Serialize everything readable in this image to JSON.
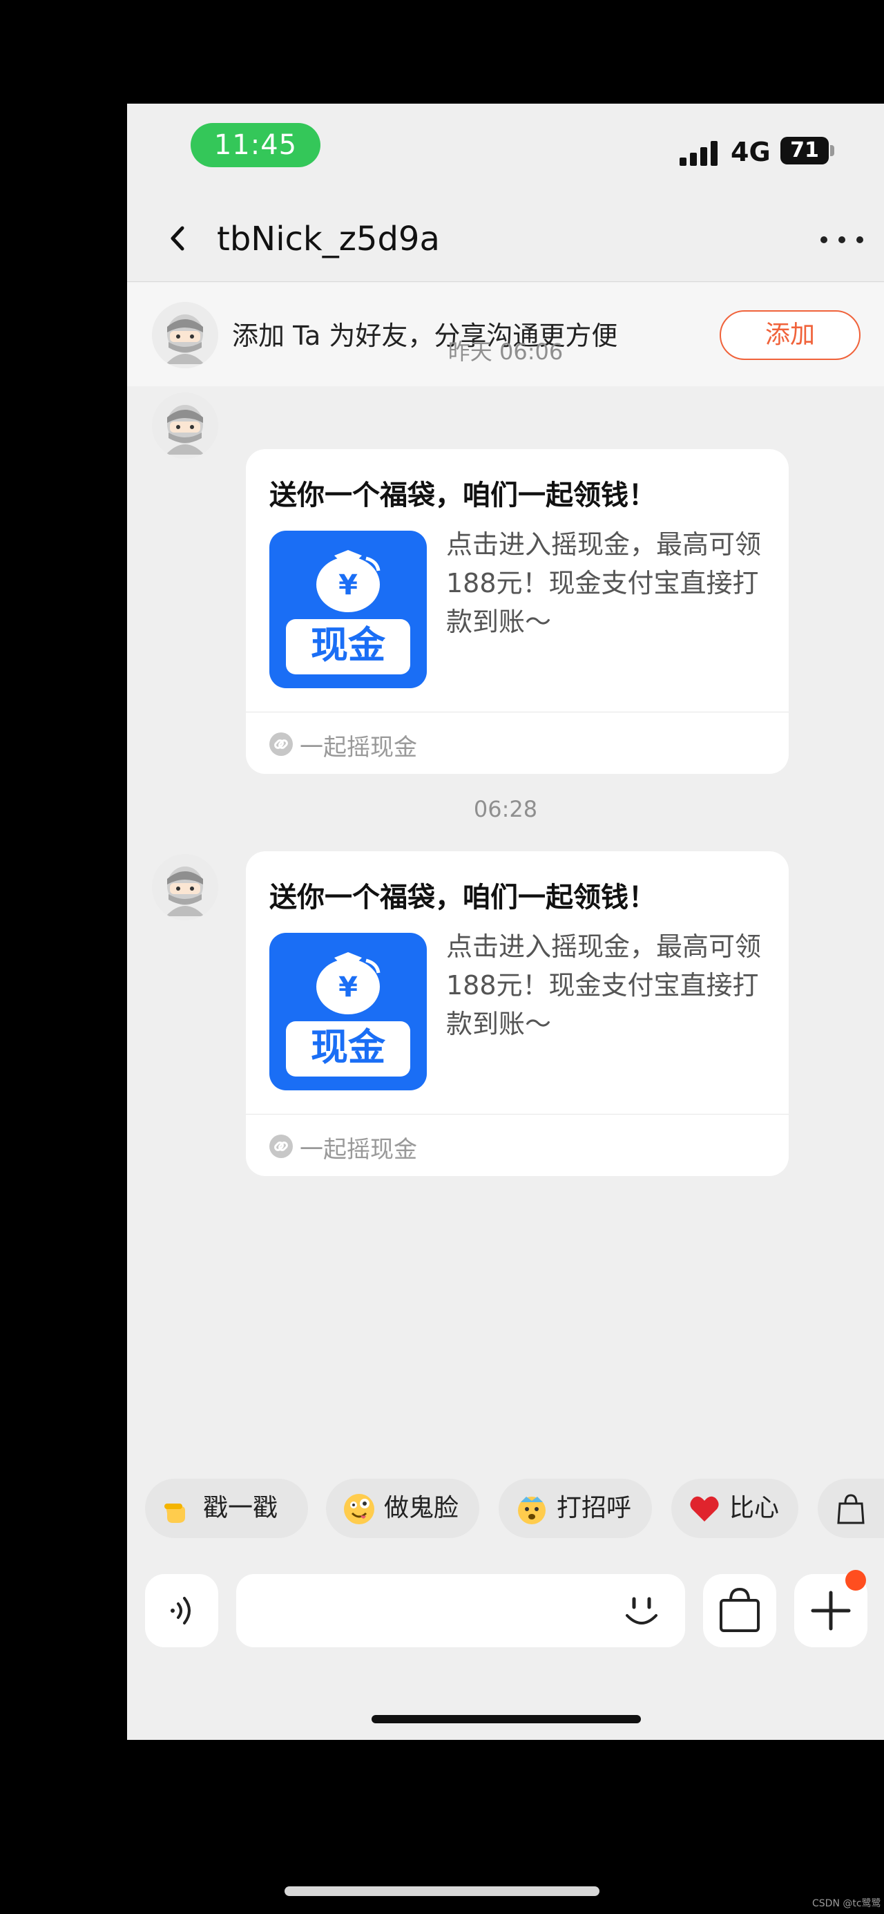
{
  "status_bar": {
    "time": "11:45",
    "network": "4G",
    "battery": "71"
  },
  "nav": {
    "title": "tbNick_z5d9a"
  },
  "add_friend": {
    "text": "添加 Ta 为好友，分享沟通更方便",
    "button": "添加"
  },
  "messages": [
    {
      "timestamp": "昨天 06:06",
      "title": "送你一个福袋，咱们一起领钱！",
      "icon_label": "现金",
      "icon_symbol": "¥",
      "description": "点击进入摇现金，最高可领188元！现金支付宝直接打款到账～",
      "link_text": "一起摇现金"
    },
    {
      "timestamp": "06:28",
      "title": "送你一个福袋，咱们一起领钱！",
      "icon_label": "现金",
      "icon_symbol": "¥",
      "description": "点击进入摇现金，最高可领188元！现金支付宝直接打款到账～",
      "link_text": "一起摇现金"
    }
  ],
  "quick_replies": [
    {
      "label": "戳一戳",
      "icon": "poke-hand-icon"
    },
    {
      "label": "做鬼脸",
      "icon": "silly-face-icon"
    },
    {
      "label": "打招呼",
      "icon": "greeting-face-icon"
    },
    {
      "label": "比心",
      "icon": "heart-icon"
    },
    {
      "label": "",
      "icon": "gift-bag-icon"
    }
  ],
  "colors": {
    "accent": "#f0623a",
    "status_pill": "#34c759",
    "icon_blue": "#1a6ef5",
    "badge": "#ff4e1f"
  },
  "watermark": "CSDN @tc鹭鹭"
}
